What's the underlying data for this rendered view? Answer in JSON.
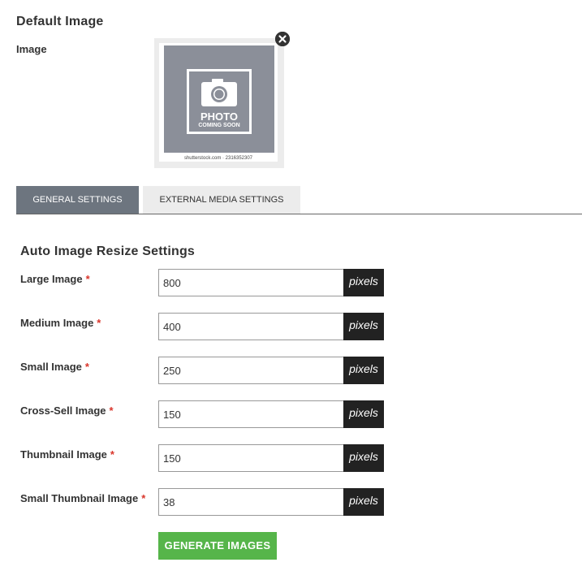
{
  "default_image": {
    "title": "Default Image",
    "field_label": "Image",
    "placeholder_text_1": "PHOTO",
    "placeholder_text_2": "COMING SOON",
    "watermark": "shutterstock.com · 2316352307",
    "remove_icon": "close-x-icon"
  },
  "tabs": [
    {
      "label": "GENERAL SETTINGS",
      "active": true
    },
    {
      "label": "EXTERNAL MEDIA SETTINGS",
      "active": false
    }
  ],
  "resize": {
    "title": "Auto Image Resize Settings",
    "required_mark": "*",
    "unit": "pixels",
    "fields": [
      {
        "label": "Large Image",
        "value": "800"
      },
      {
        "label": "Medium Image",
        "value": "400"
      },
      {
        "label": "Small Image",
        "value": "250"
      },
      {
        "label": "Cross-Sell Image",
        "value": "150"
      },
      {
        "label": "Thumbnail Image",
        "value": "150"
      },
      {
        "label": "Small Thumbnail Image",
        "value": "38"
      }
    ]
  },
  "generate_button": "GENERATE IMAGES",
  "colors": {
    "active_tab": "#6d757f",
    "inactive_tab": "#ececec",
    "addon_bg": "#222222",
    "generate_button": "#56b54a",
    "required": "#d9352b"
  }
}
